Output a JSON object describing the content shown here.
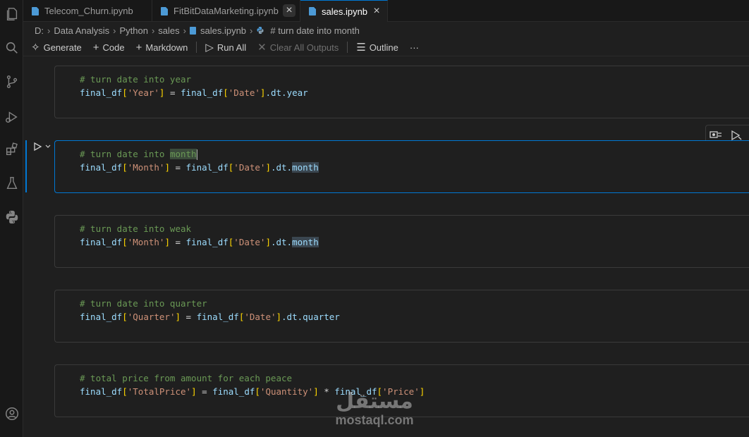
{
  "tabs": [
    {
      "label": "Telecom_Churn.ipynb",
      "active": false
    },
    {
      "label": "FitBitDataMarketing.ipynb",
      "active": false
    },
    {
      "label": "sales.ipynb",
      "active": true
    }
  ],
  "breadcrumb": [
    "D:",
    "Data Analysis",
    "Python",
    "sales",
    "sales.ipynb",
    "# turn date into month"
  ],
  "toolbar": {
    "generate": "Generate",
    "code": "Code",
    "markdown": "Markdown",
    "run_all": "Run All",
    "clear_all_outputs": "Clear All Outputs",
    "outline": "Outline",
    "more": "···"
  },
  "cells": [
    {
      "comment": "# turn date into year",
      "lhs_var": "final_df",
      "lhs_key": "'Year'",
      "rhs_var": "final_df",
      "rhs_key": "'Date'",
      "rhs_attr": ".dt.",
      "rhs_prop": "year"
    },
    {
      "comment_text": "# turn date into ",
      "comment_hl": "month",
      "lhs_var": "final_df",
      "lhs_key": "'Month'",
      "rhs_var": "final_df",
      "rhs_key": "'Date'",
      "rhs_attr": ".dt.",
      "rhs_prop": "month"
    },
    {
      "comment": "# turn date into weak",
      "lhs_var": "final_df",
      "lhs_key": "'Month'",
      "rhs_var": "final_df",
      "rhs_key": "'Date'",
      "rhs_attr": ".dt.",
      "rhs_prop": "month"
    },
    {
      "comment": "# turn date into quarter",
      "lhs_var": "final_df",
      "lhs_key": "'Quarter'",
      "rhs_var": "final_df",
      "rhs_key": "'Date'",
      "rhs_attr": ".dt.",
      "rhs_prop": "quarter"
    },
    {
      "comment": "# total price from amount for each peace",
      "lhs_var": "final_df",
      "lhs_key": "'TotalPrice'",
      "rhs_var": "final_df",
      "rhs_key": "'Quantity'",
      "op2": " * ",
      "rhs2_var": "final_df",
      "rhs2_key": "'Price'"
    }
  ],
  "watermark": {
    "arabic": "مستقل",
    "latin": "mostaql.com"
  }
}
